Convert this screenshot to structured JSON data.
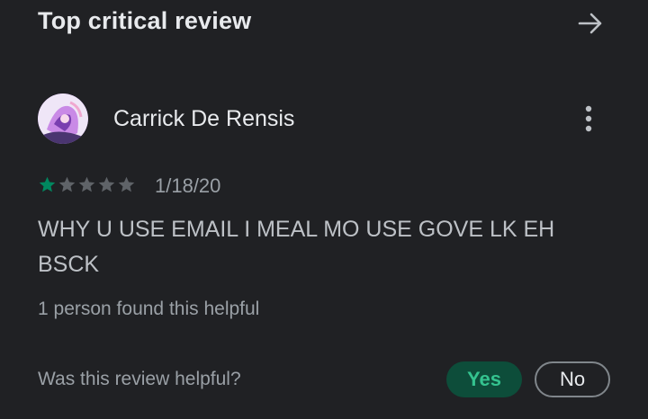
{
  "section": {
    "title": "Top critical review",
    "arrow_icon": "arrow-right-icon"
  },
  "review": {
    "author": "Carrick De Rensis",
    "avatar_icon": "user-avatar",
    "more_icon": "more-vert-icon",
    "rating": 1,
    "max_rating": 5,
    "date": "1/18/20",
    "text": "WHY U USE EMAIL I MEAL MO USE GOVE LK EH BSCK",
    "helpful_count_text": "1 person found this helpful"
  },
  "feedback": {
    "question": "Was this review helpful?",
    "yes_label": "Yes",
    "no_label": "No"
  },
  "colors": {
    "background": "#202124",
    "star_filled": "#01875f",
    "star_empty": "#5f6368",
    "yes_bg": "#0d4d3a",
    "yes_text": "#34c38f"
  }
}
